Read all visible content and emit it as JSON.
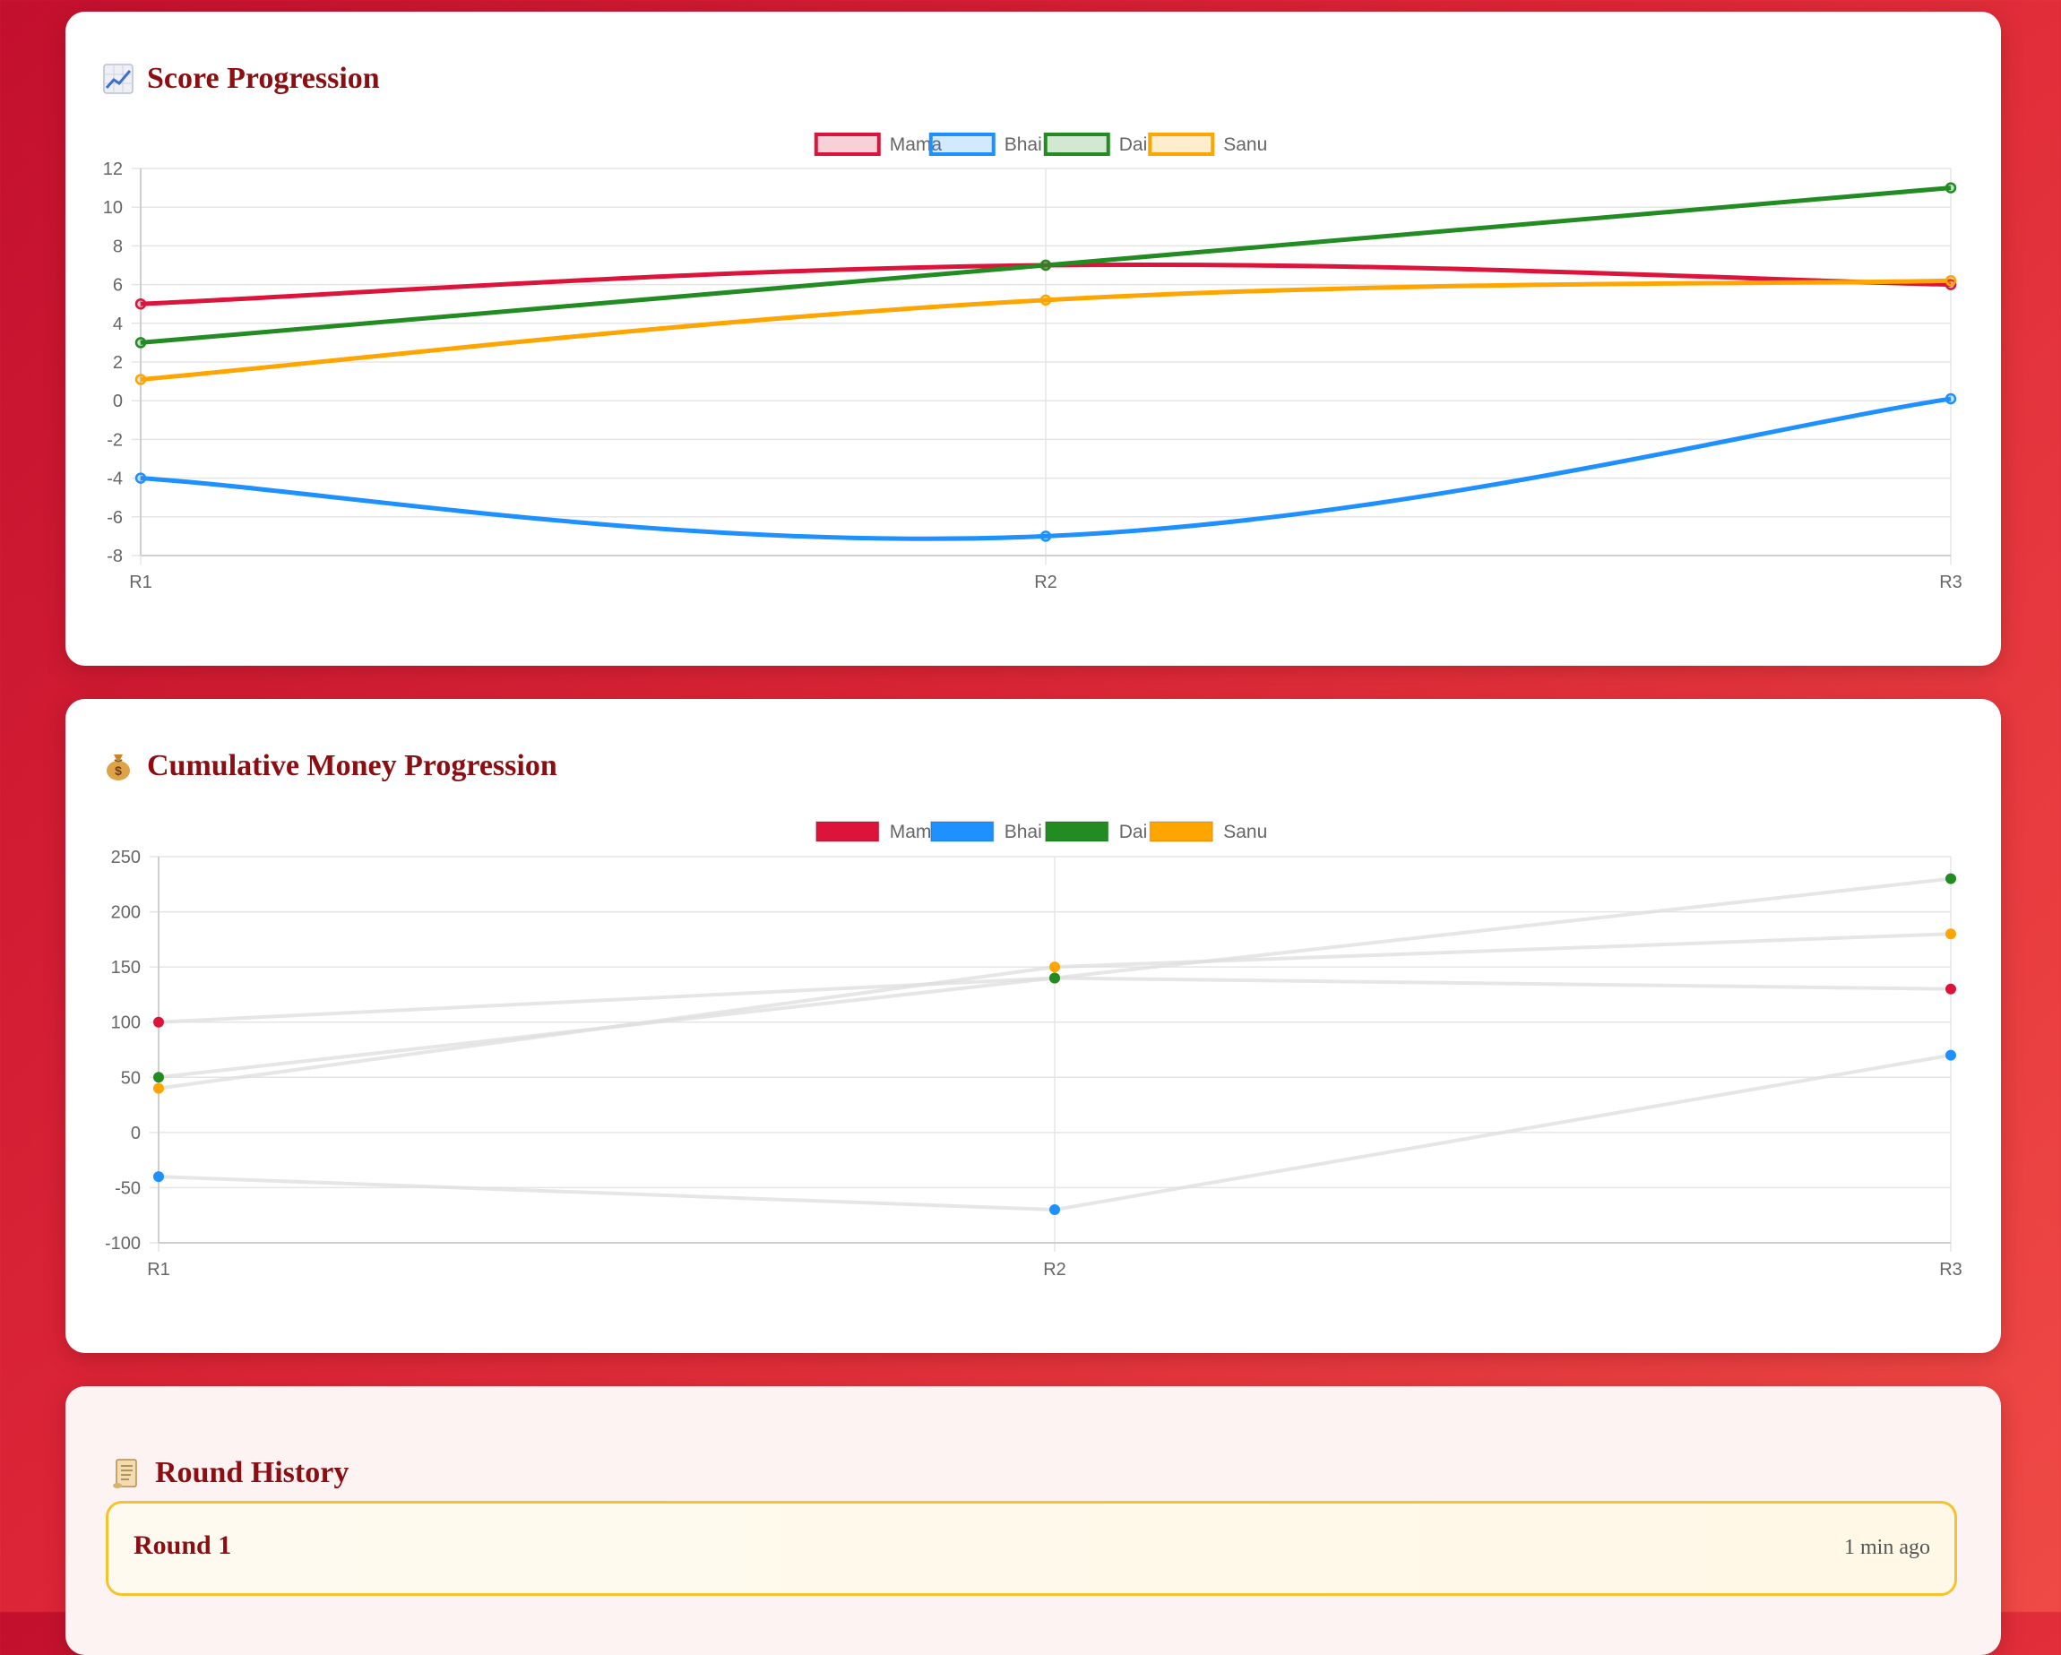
{
  "score_card": {
    "title": "Score Progression",
    "icon": "chart-increasing-icon"
  },
  "money_card": {
    "title": "Cumulative Money Progression",
    "icon": "money-bag-icon"
  },
  "history_card": {
    "title": "Round History",
    "icon": "scroll-icon",
    "rounds": [
      {
        "name": "Round 1",
        "time": "1 min ago"
      }
    ]
  },
  "chart_data": [
    {
      "type": "line",
      "title": "Score Progression",
      "categories": [
        "R1",
        "R2",
        "R3"
      ],
      "ylim": [
        -8,
        12
      ],
      "yticks": [
        12,
        10,
        8,
        6,
        4,
        2,
        0,
        -2,
        -4,
        -6,
        -8
      ],
      "grid": true,
      "legend": "top-center",
      "smooth": true,
      "series": [
        {
          "name": "Mama",
          "color": "#dc143c",
          "values": [
            5,
            7,
            6
          ]
        },
        {
          "name": "Bhai",
          "color": "#1e90ff",
          "values": [
            -4,
            -7,
            0.1
          ]
        },
        {
          "name": "Dai",
          "color": "#228b22",
          "values": [
            3,
            7,
            11
          ]
        },
        {
          "name": "Sanu",
          "color": "#ffa500",
          "values": [
            1.1,
            5.2,
            6.2
          ]
        }
      ]
    },
    {
      "type": "line",
      "title": "Cumulative Money Progression",
      "categories": [
        "R1",
        "R2",
        "R3"
      ],
      "ylim": [
        -100,
        250
      ],
      "yticks": [
        250,
        200,
        150,
        100,
        50,
        0,
        -50,
        -100
      ],
      "grid": true,
      "legend": "top-center",
      "line_color": "#dddddd",
      "series": [
        {
          "name": "Mama",
          "color": "#dc143c",
          "values": [
            100,
            140,
            130
          ]
        },
        {
          "name": "Bhai",
          "color": "#1e90ff",
          "values": [
            -40,
            -70,
            70
          ]
        },
        {
          "name": "Dai",
          "color": "#228b22",
          "values": [
            50,
            140,
            230
          ]
        },
        {
          "name": "Sanu",
          "color": "#ffa500",
          "values": [
            40,
            150,
            180
          ]
        }
      ]
    }
  ]
}
